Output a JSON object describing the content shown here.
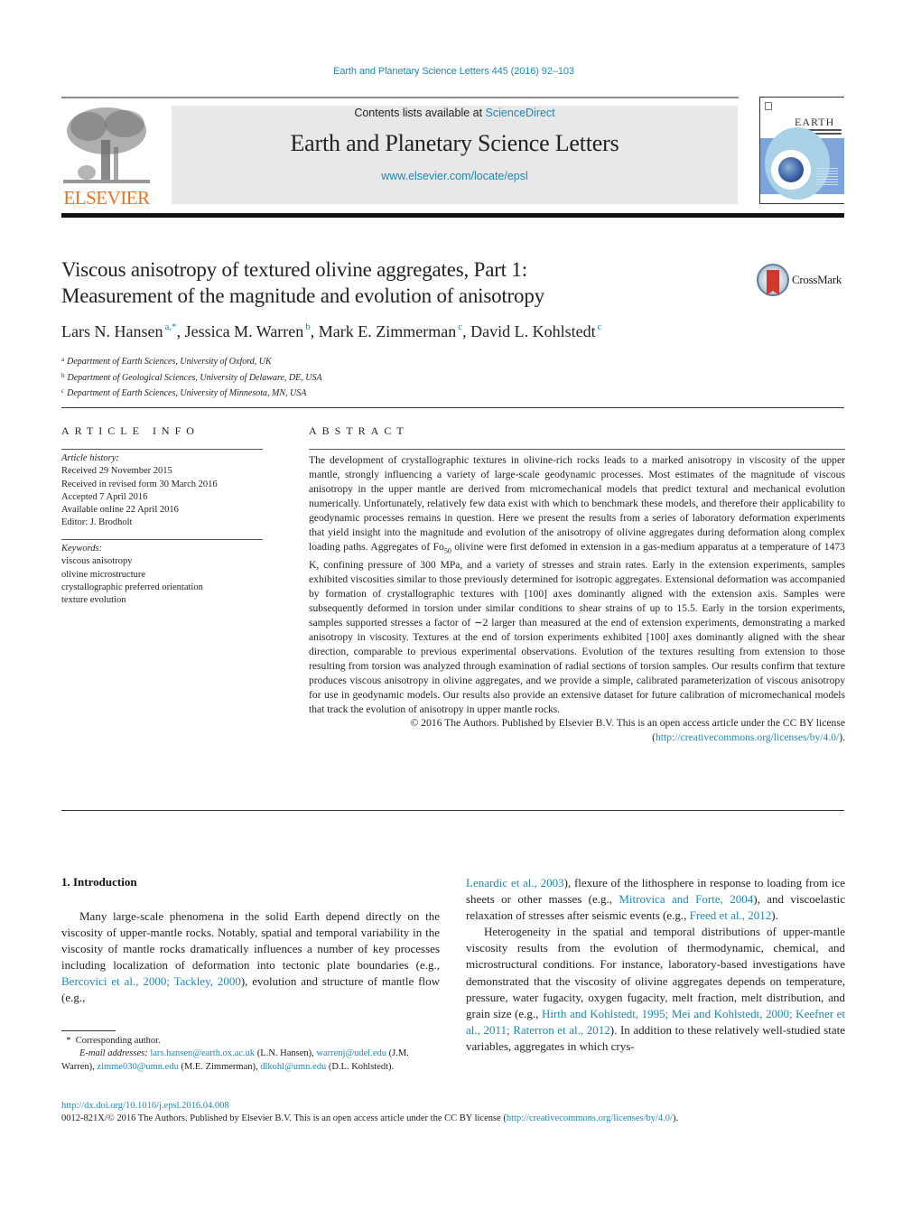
{
  "header": {
    "journal_ref": "Earth and Planetary Science Letters 445 (2016) 92–103",
    "contents_prefix": "Contents lists available at ",
    "contents_link": "ScienceDirect",
    "journal_name": "Earth and Planetary Science Letters",
    "journal_url": "www.elsevier.com/locate/epsl",
    "publisher_logo_text": "ELSEVIER",
    "cover_title": "EARTH",
    "colors": {
      "link": "#1f87b4",
      "publisher_orange": "#e8731f",
      "banner_bg": "#e8e8e8"
    }
  },
  "article": {
    "title_line1": "Viscous anisotropy of textured olivine aggregates, Part 1:",
    "title_line2": "Measurement of the magnitude and evolution of anisotropy",
    "crossmark_label": "CrossMark",
    "authors": [
      {
        "name": "Lars N. Hansen",
        "sup": "a,*",
        "sep": ", "
      },
      {
        "name": "Jessica M. Warren",
        "sup": "b",
        "sep": ", "
      },
      {
        "name": "Mark E. Zimmerman",
        "sup": "c",
        "sep": ", "
      },
      {
        "name": "David L. Kohlstedt",
        "sup": "c",
        "sep": ""
      }
    ],
    "affiliations": [
      {
        "key": "a",
        "text": "Department of Earth Sciences, University of Oxford, UK"
      },
      {
        "key": "b",
        "text": "Department of Geological Sciences, University of Delaware, DE, USA"
      },
      {
        "key": "c",
        "text": "Department of Earth Sciences, University of Minnesota, MN, USA"
      }
    ]
  },
  "article_info": {
    "heading": "ARTICLE INFO",
    "history_label": "Article history:",
    "history": [
      "Received 29 November 2015",
      "Received in revised form 30 March 2016",
      "Accepted 7 April 2016",
      "Available online 22 April 2016",
      "Editor: J. Brodholt"
    ],
    "keywords_label": "Keywords:",
    "keywords": [
      "viscous anisotropy",
      "olivine microstructure",
      "crystallographic preferred orientation",
      "texture evolution"
    ]
  },
  "abstract": {
    "heading": "ABSTRACT",
    "text_part1": "The development of crystallographic textures in olivine-rich rocks leads to a marked anisotropy in viscosity of the upper mantle, strongly influencing a variety of large-scale geodynamic processes. Most estimates of the magnitude of viscous anisotropy in the upper mantle are derived from micromechanical models that predict textural and mechanical evolution numerically. Unfortunately, relatively few data exist with which to benchmark these models, and therefore their applicability to geodynamic processes remains in question. Here we present the results from a series of laboratory deformation experiments that yield insight into the magnitude and evolution of the anisotropy of olivine aggregates during deformation along complex loading paths. Aggregates of Fo",
    "subscript": "50",
    "text_part2": " olivine were first defomed in extension in a gas-medium apparatus at a temperature of 1473 K, confining pressure of 300 MPa, and a variety of stresses and strain rates. Early in the extension experiments, samples exhibited viscosities similar to those previously determined for isotropic aggregates. Extensional deformation was accompanied by formation of crystallographic textures with [100] axes dominantly aligned with the extension axis. Samples were subsequently deformed in torsion under similar conditions to shear strains of up to 15.5. Early in the torsion experiments, samples supported stresses a factor of ∼2 larger than measured at the end of extension experiments, demonstrating a marked anisotropy in viscosity. Textures at the end of torsion experiments exhibited [100] axes dominantly aligned with the shear direction, comparable to previous experimental observations. Evolution of the textures resulting from extension to those resulting from torsion was analyzed through examination of radial sections of torsion samples. Our results confirm that texture produces viscous anisotropy in olivine aggregates, and we provide a simple, calibrated parameterization of viscous anisotropy for use in geodynamic models. Our results also provide an extensive dataset for future calibration of micromechanical models that track the evolution of anisotropy in upper mantle rocks.",
    "copyright": "© 2016 The Authors. Published by Elsevier B.V. This is an open access article under the CC BY license",
    "license_open": "(",
    "license_link": "http://creativecommons.org/licenses/by/4.0/",
    "license_close": ")."
  },
  "introduction": {
    "heading": "1. Introduction",
    "left_p1_a": "Many large-scale phenomena in the solid Earth depend directly on the viscosity of upper-mantle rocks. Notably, spatial and temporal variability in the viscosity of mantle rocks dramatically influences a number of key processes including localization of deformation into tectonic plate boundaries (e.g., ",
    "left_p1_link1": "Bercovici et al., 2000; Tackley, 2000",
    "left_p1_b": "), evolution and structure of mantle flow (e.g., ",
    "right_p1_link1": "Lenardic et al., 2003",
    "right_p1_a": "), flexure of the lithosphere in response to loading from ice sheets or other masses (e.g., ",
    "right_p1_link2": "Mitrovica and Forte, 2004",
    "right_p1_b": "), and viscoelastic relaxation of stresses after seismic events (e.g., ",
    "right_p1_link3": "Freed et al., 2012",
    "right_p1_c": ").",
    "right_p2_a": "Heterogeneity in the spatial and temporal distributions of upper-mantle viscosity results from the evolution of thermodynamic, chemical, and microstructural conditions. For instance, laboratory-based investigations have demonstrated that the viscosity of olivine aggregates depends on temperature, pressure, water fugacity, oxygen fugacity, melt fraction, melt distribution, and grain size (e.g., ",
    "right_p2_link1": "Hirth and Kohlstedt, 1995; Mei and Kohlstedt, 2000; Keefner et al., 2011; Raterron et al., 2012",
    "right_p2_b": "). In addition to these relatively well-studied state variables, aggregates in which crys-"
  },
  "footnotes": {
    "corresponding_marker": "*",
    "corresponding": "Corresponding author.",
    "email_label": "E-mail addresses:",
    "emails": [
      {
        "address": "lars.hansen@earth.ox.ac.uk",
        "who": " (L.N. Hansen), "
      },
      {
        "address": "warrenj@udel.edu",
        "who": " (J.M. Warren), "
      },
      {
        "address": "zimme030@umn.edu",
        "who": " (M.E. Zimmerman), "
      },
      {
        "address": "dlkohl@umn.edu",
        "who": " (D.L. Kohlstedt)."
      }
    ]
  },
  "footer": {
    "doi": "http://dx.doi.org/10.1016/j.epsl.2016.04.008",
    "issn_text": "0012-821X/© 2016 The Authors. Published by Elsevier B.V. This is an open access article under the CC BY license (",
    "license_link": "http://creativecommons.org/licenses/by/4.0/",
    "license_close": ")."
  }
}
